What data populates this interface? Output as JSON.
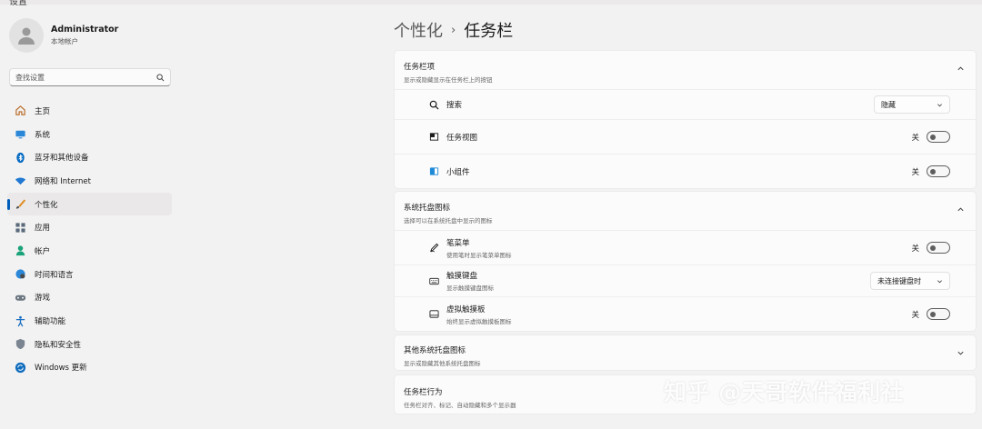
{
  "window": {
    "back_label": "设置"
  },
  "profile": {
    "name": "Administrator",
    "account_type": "本地帐户"
  },
  "search": {
    "placeholder": "查找设置"
  },
  "sidebar": {
    "items": [
      {
        "label": "主页",
        "icon": "home-icon"
      },
      {
        "label": "系统",
        "icon": "system-icon"
      },
      {
        "label": "蓝牙和其他设备",
        "icon": "bluetooth-icon"
      },
      {
        "label": "网络和 Internet",
        "icon": "wifi-icon"
      },
      {
        "label": "个性化",
        "icon": "brush-icon",
        "active": true
      },
      {
        "label": "应用",
        "icon": "apps-icon"
      },
      {
        "label": "帐户",
        "icon": "account-icon"
      },
      {
        "label": "时间和语言",
        "icon": "globe-icon"
      },
      {
        "label": "游戏",
        "icon": "gamepad-icon"
      },
      {
        "label": "辅助功能",
        "icon": "accessibility-icon"
      },
      {
        "label": "隐私和安全性",
        "icon": "shield-icon"
      },
      {
        "label": "Windows 更新",
        "icon": "update-icon"
      }
    ]
  },
  "breadcrumb": {
    "parent": "个性化",
    "separator": "›",
    "current": "任务栏"
  },
  "sections": {
    "taskbar_items": {
      "title": "任务栏项",
      "subtitle": "显示或隐藏显示在任务栏上的按钮",
      "rows": {
        "search": {
          "label": "搜索",
          "value": "隐藏"
        },
        "task_view": {
          "label": "任务视图",
          "state": "关"
        },
        "widgets": {
          "label": "小组件",
          "state": "关"
        }
      }
    },
    "tray_icons": {
      "title": "系统托盘图标",
      "subtitle": "选择可以在系统托盘中显示的图标",
      "rows": {
        "pen_menu": {
          "label": "笔菜单",
          "desc": "使用笔时显示笔菜单图标",
          "state": "关"
        },
        "touch_keyboard": {
          "label": "触摸键盘",
          "desc": "显示触摸键盘图标",
          "value": "未连接键盘时"
        },
        "touchpad": {
          "label": "虚拟触摸板",
          "desc": "始终显示虚拟触摸板图标",
          "state": "关"
        }
      }
    },
    "other_tray": {
      "title": "其他系统托盘图标",
      "subtitle": "显示或隐藏其他系统托盘图标"
    },
    "behaviors": {
      "title": "任务栏行为",
      "subtitle": "任务栏对齐、标记、自动隐藏和多个显示器"
    }
  },
  "watermark": "知乎 @天哥软件福利社",
  "colors": {
    "accent": "#005fb8",
    "background": "#f3f2f2",
    "card": "#fbfbfb"
  }
}
